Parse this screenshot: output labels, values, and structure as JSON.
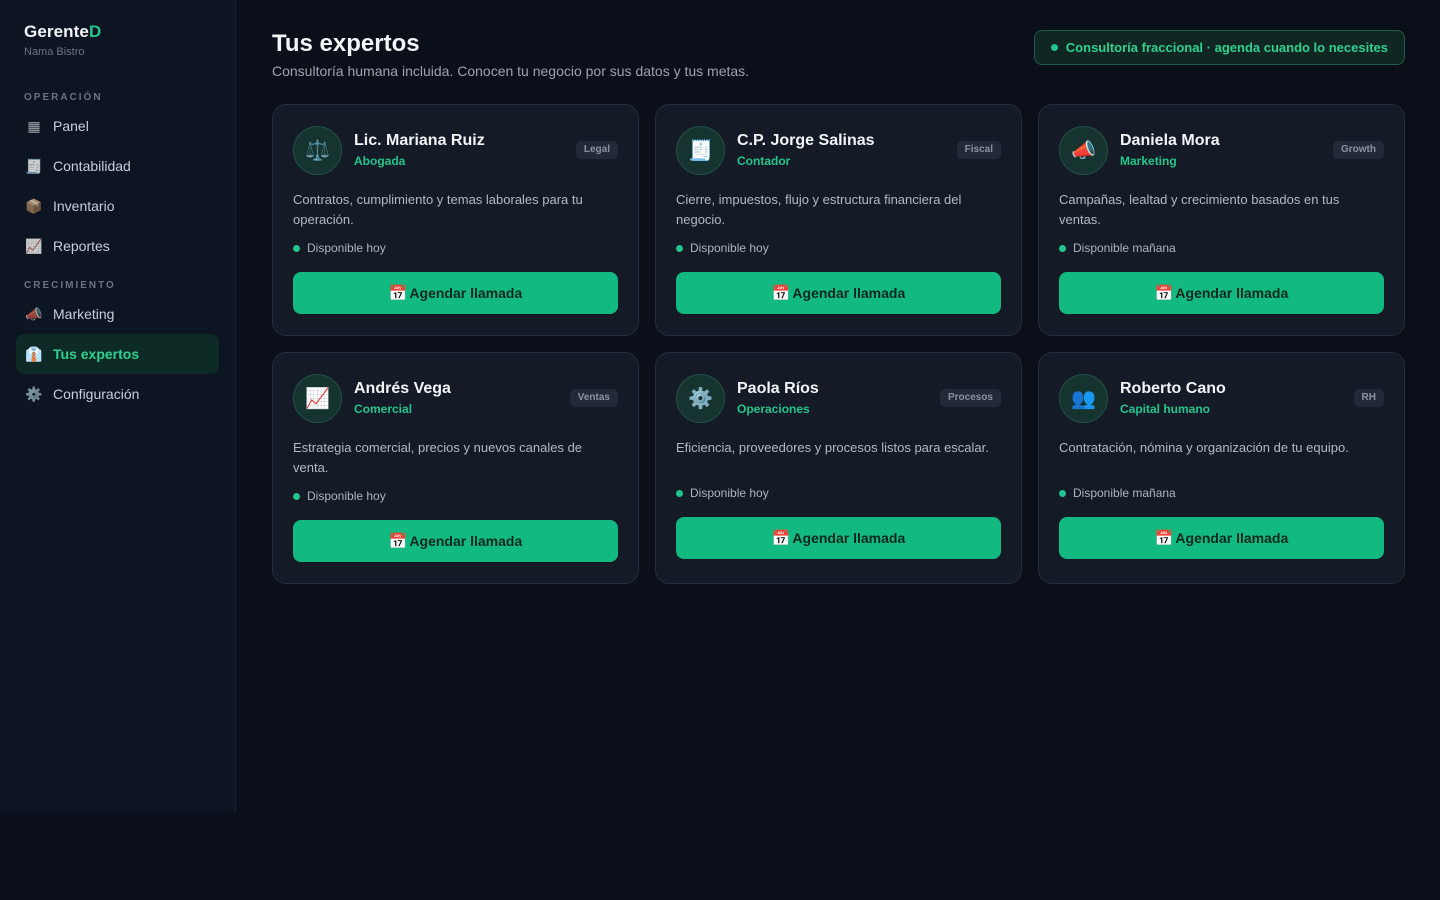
{
  "brand": {
    "name_main": "Gerente",
    "name_accent": "D",
    "subtitle": "Nama Bistro"
  },
  "sidebar": {
    "sections": [
      {
        "label": "Operación",
        "items": [
          {
            "label": "Panel",
            "icon": "grid-icon",
            "glyph": "▦"
          },
          {
            "label": "Contabilidad",
            "icon": "ledger-icon",
            "glyph": "🧾"
          },
          {
            "label": "Inventario",
            "icon": "package-icon",
            "glyph": "📦"
          },
          {
            "label": "Reportes",
            "icon": "chart-icon",
            "glyph": "📈"
          }
        ]
      },
      {
        "label": "Crecimiento",
        "items": [
          {
            "label": "Marketing",
            "icon": "megaphone-icon",
            "glyph": "📣"
          },
          {
            "label": "Tus expertos",
            "icon": "expert-icon",
            "glyph": "👔",
            "active": true
          },
          {
            "label": "Configuración",
            "icon": "gear-icon",
            "glyph": "⚙️"
          }
        ]
      }
    ]
  },
  "header": {
    "title": "Tus expertos",
    "subtitle": "Consultoría humana incluida. Conocen tu negocio por sus datos y tus metas.",
    "badge": "Consultoría fraccional · agenda cuando lo necesites"
  },
  "colors": {
    "accent": "#22c58b",
    "button": "#12b981",
    "background": "#0b0f1a",
    "card": "#141a26"
  },
  "experts": [
    {
      "name": "Lic. Mariana Ruiz",
      "role": "Abogada",
      "tag": "Legal",
      "icon": "scales-icon",
      "glyph": "⚖️",
      "description": "Contratos, cumplimiento y temas laborales para tu operación.",
      "availability": "Disponible hoy",
      "cta": "Agendar llamada"
    },
    {
      "name": "C.P. Jorge Salinas",
      "role": "Contador",
      "tag": "Fiscal",
      "icon": "receipt-icon",
      "glyph": "🧾",
      "description": "Cierre, impuestos, flujo y estructura financiera del negocio.",
      "availability": "Disponible hoy",
      "cta": "Agendar llamada"
    },
    {
      "name": "Daniela Mora",
      "role": "Marketing",
      "tag": "Growth",
      "icon": "megaphone-icon",
      "glyph": "📣",
      "description": "Campañas, lealtad y crecimiento basados en tus ventas.",
      "availability": "Disponible mañana",
      "cta": "Agendar llamada"
    },
    {
      "name": "Andrés Vega",
      "role": "Comercial",
      "tag": "Ventas",
      "icon": "chart-up-icon",
      "glyph": "📈",
      "description": "Estrategia comercial, precios y nuevos canales de venta.",
      "availability": "Disponible hoy",
      "cta": "Agendar llamada"
    },
    {
      "name": "Paola Ríos",
      "role": "Operaciones",
      "tag": "Procesos",
      "icon": "gear-icon",
      "glyph": "⚙️",
      "description": "Eficiencia, proveedores y procesos listos para escalar.",
      "availability": "Disponible hoy",
      "cta": "Agendar llamada"
    },
    {
      "name": "Roberto Cano",
      "role": "Capital humano",
      "tag": "RH",
      "icon": "people-icon",
      "glyph": "👥",
      "description": "Contratación, nómina y organización de tu equipo.",
      "availability": "Disponible mañana",
      "cta": "Agendar llamada"
    }
  ],
  "cta_icon": {
    "icon": "calendar-icon",
    "glyph": "📅"
  }
}
